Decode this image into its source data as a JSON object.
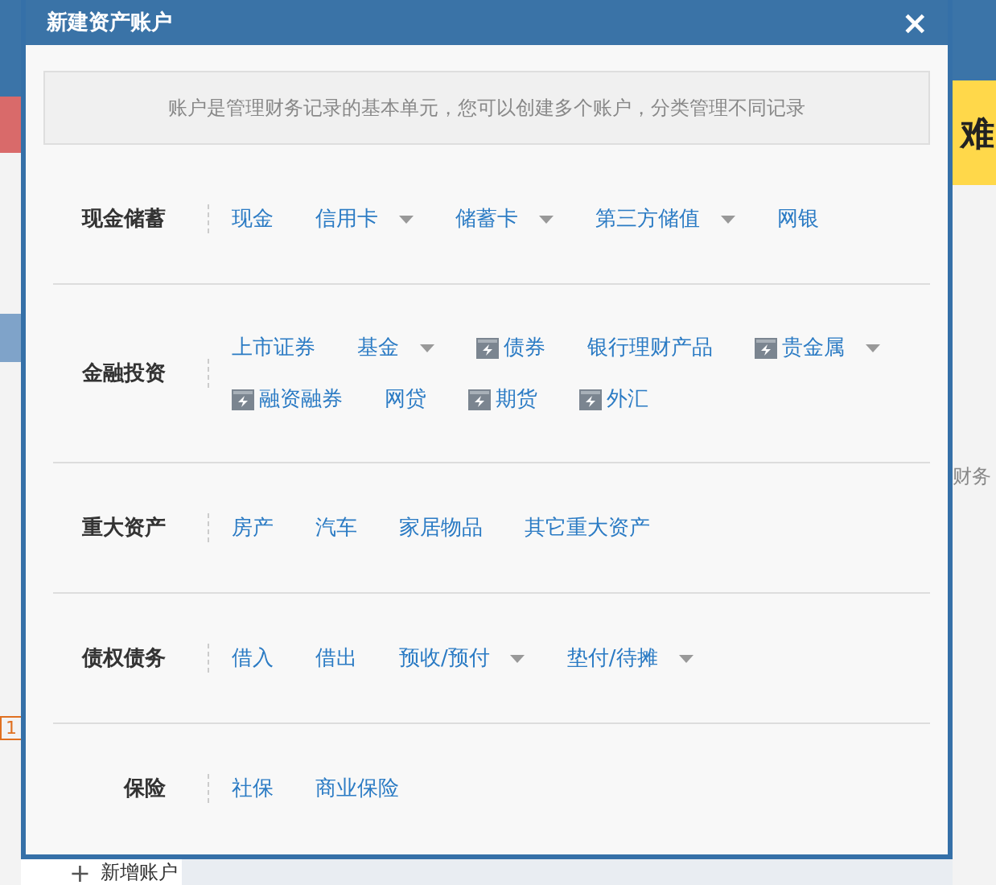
{
  "background": {
    "right_heading": "难",
    "right_label": "财务",
    "left_badge": "1",
    "add_icon": "+",
    "add_account": "新增账户"
  },
  "dialog": {
    "title": "新建资产账户",
    "close": "×",
    "description": "账户是管理财务记录的基本单元，您可以创建多个账户，分类管理不同记录",
    "sections": [
      {
        "label": "现金储蓄",
        "items": [
          {
            "label": "现金",
            "icon": false,
            "dropdown": false
          },
          {
            "label": "信用卡",
            "icon": false,
            "dropdown": true
          },
          {
            "label": "储蓄卡",
            "icon": false,
            "dropdown": true
          },
          {
            "label": "第三方储值",
            "icon": false,
            "dropdown": true
          },
          {
            "label": "网银",
            "icon": false,
            "dropdown": false
          }
        ]
      },
      {
        "label": "金融投资",
        "items": [
          {
            "label": "上市证券",
            "icon": false,
            "dropdown": false
          },
          {
            "label": "基金",
            "icon": false,
            "dropdown": true
          },
          {
            "label": "债券",
            "icon": true,
            "dropdown": false
          },
          {
            "label": "银行理财产品",
            "icon": false,
            "dropdown": false
          },
          {
            "label": "贵金属",
            "icon": true,
            "dropdown": true
          },
          {
            "label": "融资融券",
            "icon": true,
            "dropdown": false
          },
          {
            "label": "网贷",
            "icon": false,
            "dropdown": false
          },
          {
            "label": "期货",
            "icon": true,
            "dropdown": false
          },
          {
            "label": "外汇",
            "icon": true,
            "dropdown": false
          }
        ]
      },
      {
        "label": "重大资产",
        "items": [
          {
            "label": "房产",
            "icon": false,
            "dropdown": false
          },
          {
            "label": "汽车",
            "icon": false,
            "dropdown": false
          },
          {
            "label": "家居物品",
            "icon": false,
            "dropdown": false
          },
          {
            "label": "其它重大资产",
            "icon": false,
            "dropdown": false
          }
        ]
      },
      {
        "label": "债权债务",
        "items": [
          {
            "label": "借入",
            "icon": false,
            "dropdown": false
          },
          {
            "label": "借出",
            "icon": false,
            "dropdown": false
          },
          {
            "label": "预收/预付",
            "icon": false,
            "dropdown": true
          },
          {
            "label": "垫付/待摊",
            "icon": false,
            "dropdown": true
          }
        ]
      },
      {
        "label": "保险",
        "items": [
          {
            "label": "社保",
            "icon": false,
            "dropdown": false
          },
          {
            "label": "商业保险",
            "icon": false,
            "dropdown": false
          }
        ]
      }
    ]
  }
}
